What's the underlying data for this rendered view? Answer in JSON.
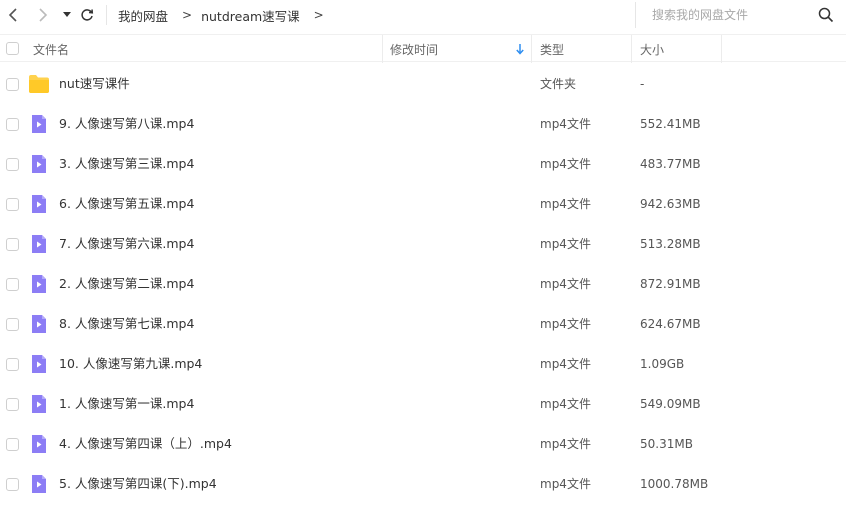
{
  "toolbar": {
    "back_icon": "chevron-left-icon",
    "forward_icon": "chevron-right-icon",
    "history_icon": "caret-down-icon",
    "refresh_icon": "refresh-icon"
  },
  "breadcrumb": {
    "items": [
      "我的网盘",
      "nutdream速写课"
    ],
    "separator": ">"
  },
  "search": {
    "placeholder": "搜索我的网盘文件",
    "value": ""
  },
  "columns": {
    "name": "文件名",
    "modified": "修改时间",
    "type": "类型",
    "size": "大小",
    "sort_icon": "sort-down-arrow-icon"
  },
  "files": [
    {
      "name": "nut速写课件",
      "type": "文件夹",
      "size": "-",
      "icon": "folder-icon"
    },
    {
      "name": "9. 人像速写第八课.mp4",
      "type": "mp4文件",
      "size": "552.41MB",
      "icon": "video-file-icon"
    },
    {
      "name": "3. 人像速写第三课.mp4",
      "type": "mp4文件",
      "size": "483.77MB",
      "icon": "video-file-icon"
    },
    {
      "name": "6. 人像速写第五课.mp4",
      "type": "mp4文件",
      "size": "942.63MB",
      "icon": "video-file-icon"
    },
    {
      "name": "7. 人像速写第六课.mp4",
      "type": "mp4文件",
      "size": "513.28MB",
      "icon": "video-file-icon"
    },
    {
      "name": "2. 人像速写第二课.mp4",
      "type": "mp4文件",
      "size": "872.91MB",
      "icon": "video-file-icon"
    },
    {
      "name": "8. 人像速写第七课.mp4",
      "type": "mp4文件",
      "size": "624.67MB",
      "icon": "video-file-icon"
    },
    {
      "name": "10. 人像速写第九课.mp4",
      "type": "mp4文件",
      "size": "1.09GB",
      "icon": "video-file-icon"
    },
    {
      "name": "1. 人像速写第一课.mp4",
      "type": "mp4文件",
      "size": "549.09MB",
      "icon": "video-file-icon"
    },
    {
      "name": "4. 人像速写第四课（上）.mp4",
      "type": "mp4文件",
      "size": "50.31MB",
      "icon": "video-file-icon"
    },
    {
      "name": "5. 人像速写第四课(下).mp4",
      "type": "mp4文件",
      "size": "1000.78MB",
      "icon": "video-file-icon"
    }
  ],
  "colors": {
    "folder": "#FFD24D",
    "video_icon": "#8C7DF5",
    "sort_arrow": "#2E8EF0"
  }
}
